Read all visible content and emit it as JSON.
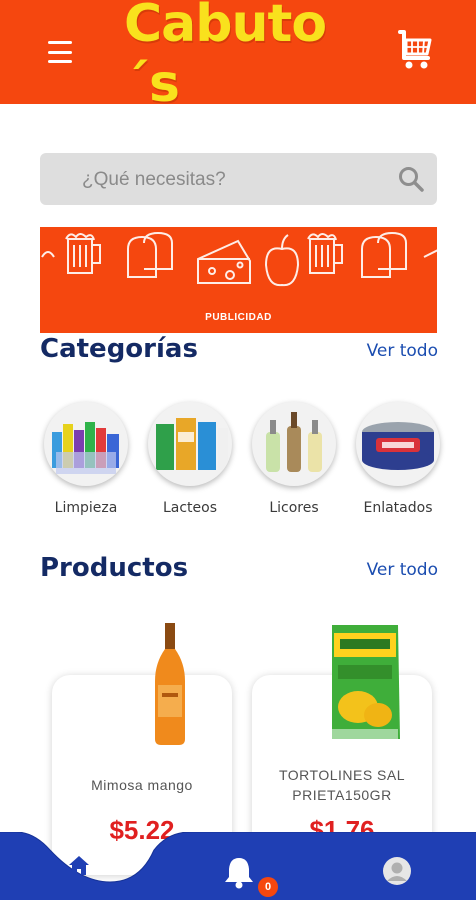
{
  "app": {
    "name": "Cabuto's"
  },
  "header": {
    "menu_icon": "hamburger-menu-icon",
    "logo_text": "Cabuto´s",
    "cart_icon": "shopping-cart-icon",
    "colors": {
      "bar": "#f5470f",
      "logo": "#f9e11d"
    }
  },
  "search": {
    "placeholder": "¿Qué necesitas?",
    "value": "",
    "icon": "search-icon"
  },
  "banner": {
    "label": "PUBLICIDAD"
  },
  "categories": {
    "title": "Categorías",
    "see_all": "Ver todo",
    "items": [
      {
        "label": "Limpieza"
      },
      {
        "label": "Lacteos"
      },
      {
        "label": "Licores"
      },
      {
        "label": "Enlatados"
      }
    ]
  },
  "products": {
    "title": "Productos",
    "see_all": "Ver todo",
    "items": [
      {
        "name": "Mimosa mango",
        "price": "$5.22"
      },
      {
        "name": "TORTOLINES SAL PRIETA150GR",
        "price": "$1.76"
      }
    ]
  },
  "bottom_nav": {
    "items": [
      {
        "icon": "home-icon",
        "active": true
      },
      {
        "icon": "bell-icon",
        "badge": "0"
      },
      {
        "icon": "user-profile-icon"
      }
    ],
    "colors": {
      "bar": "#1f3fb4",
      "active": "#1f3fb4"
    }
  }
}
